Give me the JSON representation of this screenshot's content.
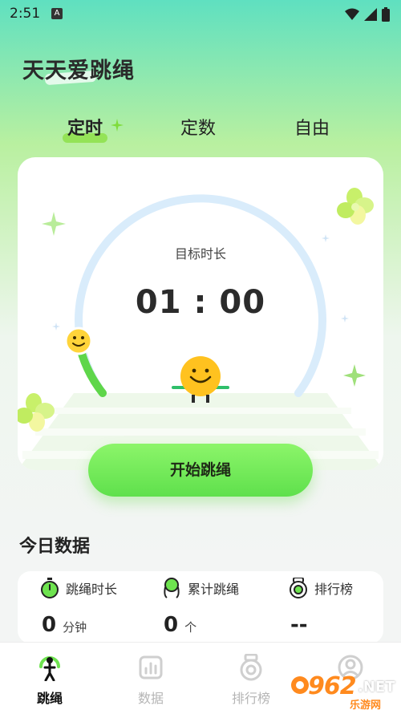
{
  "status_bar": {
    "time": "2:51",
    "notification_glyph": "A"
  },
  "app": {
    "title": "天天爱跳绳"
  },
  "mode_tabs": [
    {
      "label": "定时",
      "active": true
    },
    {
      "label": "定数",
      "active": false
    },
    {
      "label": "自由",
      "active": false
    }
  ],
  "timer_card": {
    "target_label": "目标时长",
    "target_value": "01 : 00",
    "progress_fraction": 0.12
  },
  "start_button": {
    "label": "开始跳绳"
  },
  "today": {
    "section_title": "今日数据",
    "stats": [
      {
        "label": "跳绳时长",
        "value": "0",
        "unit": "分钟",
        "icon": "stopwatch-icon"
      },
      {
        "label": "累计跳绳",
        "value": "0",
        "unit": "个",
        "icon": "jump-rope-icon"
      },
      {
        "label": "排行榜",
        "value": "--",
        "unit": "",
        "icon": "ranking-icon"
      }
    ]
  },
  "bottom_nav": [
    {
      "label": "跳绳",
      "icon": "jump-person-icon",
      "active": true
    },
    {
      "label": "数据",
      "icon": "bar-chart-icon",
      "active": false
    },
    {
      "label": "排行榜",
      "icon": "ranking-icon",
      "active": false
    },
    {
      "label": "",
      "icon": "profile-icon",
      "active": false
    }
  ],
  "watermark": {
    "text": "962",
    "suffix": ".NET",
    "sub": "乐游网"
  },
  "colors": {
    "accent_green": "#6ee34f",
    "ring_track": "#d9ecfb",
    "ring_progress": "#5fd64a",
    "inactive_nav": "#b5b5b5"
  }
}
